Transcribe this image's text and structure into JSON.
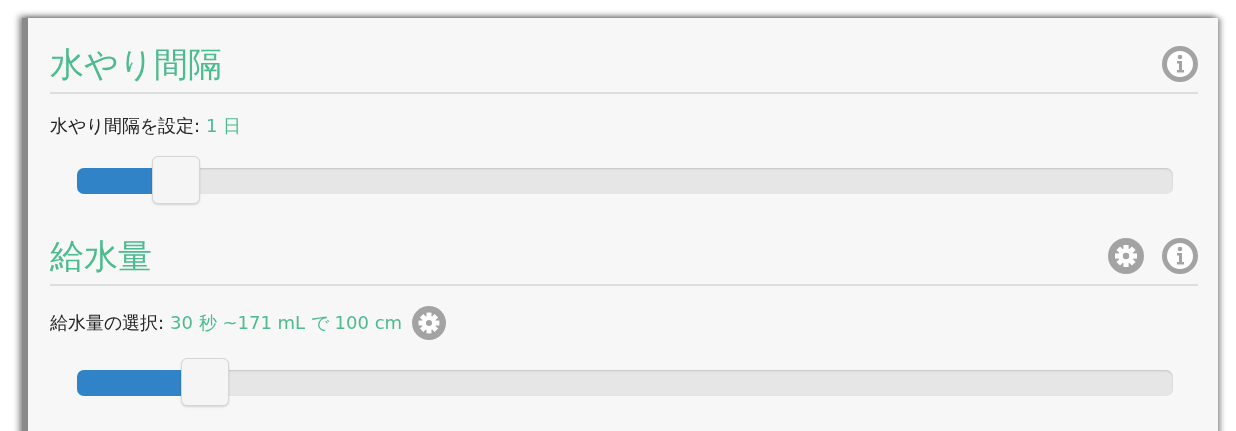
{
  "sections": [
    {
      "title": "水やり間隔",
      "header_icons": [
        {
          "kind": "info"
        }
      ],
      "label": "水やり間隔を設定:",
      "value": "1 日",
      "slider": {
        "level": 0.09
      }
    },
    {
      "title": "給水量",
      "header_icons": [
        {
          "kind": "gear"
        },
        {
          "kind": "info"
        }
      ],
      "label": "給水量の選択:",
      "value": "30 秒 ~171 mL で 100 cm",
      "value_icons": [
        {
          "kind": "gear"
        }
      ],
      "slider": {
        "level": 0.117
      }
    }
  ]
}
